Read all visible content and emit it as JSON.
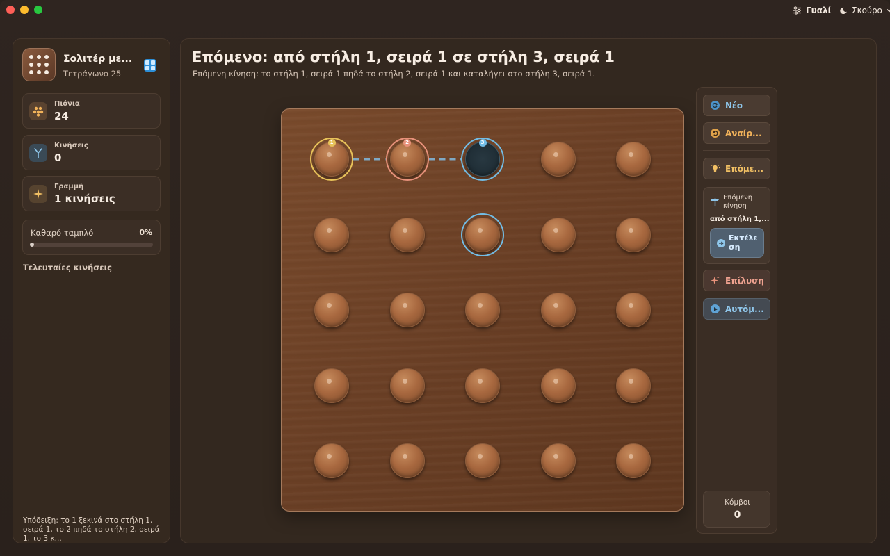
{
  "window": {
    "toolbar": {
      "glass_label": "Γυαλί",
      "theme_label": "Σκούρο"
    }
  },
  "sidebar": {
    "app_title": "Σολιτέρ με...",
    "app_subtitle": "Τετράγωνο 25",
    "stats": [
      {
        "label": "Πιόνια",
        "value": "24",
        "icon": "pegs-icon"
      },
      {
        "label": "Κινήσεις",
        "value": "0",
        "icon": "moves-icon"
      },
      {
        "label": "Γραμμή",
        "value": "1 κινήσεις",
        "icon": "sparkle-icon"
      }
    ],
    "progress": {
      "label": "Καθαρό ταμπλό",
      "percent_text": "0%",
      "value": 0
    },
    "recent_title": "Τελευταίες κινήσεις",
    "hint": "Υπόδειξη: το 1 ξεκινά στο στήλη 1, σειρά 1, το 2 πηδά το στήλη 2, σειρά 1, το 3 κ..."
  },
  "main": {
    "title": "Επόμενο: από στήλη 1, σειρά 1 σε στήλη 3, σειρά 1",
    "subtitle": "Επόμενη κίνηση: το στήλη 1, σειρά 1 πηδά το στήλη 2, σειρά 1 και καταλήγει στο στήλη 3, σειρά 1."
  },
  "board": {
    "rows": 5,
    "cols": 5,
    "empty_cells": [
      [
        0,
        2
      ]
    ],
    "highlights": [
      {
        "row": 0,
        "col": 0,
        "badge": "1",
        "color": "#e8c35a"
      },
      {
        "row": 0,
        "col": 1,
        "badge": "2",
        "color": "#e8927b"
      },
      {
        "row": 0,
        "col": 2,
        "badge": "3",
        "color": "#72bde6"
      },
      {
        "row": 1,
        "col": 2,
        "badge": "",
        "color": "#72bde6"
      }
    ],
    "path_color": "#7fa9c4"
  },
  "actions": {
    "new_label": "Νέο",
    "undo_label": "Αναίρ...",
    "hint_label": "Επόμε...",
    "next_move_title": "Επόμενη κίνηση",
    "next_move_detail": "από στήλη 1,...",
    "execute_label": "Εκτέλε ση",
    "solve_label": "Επίλυση",
    "auto_label": "Αυτόμ...",
    "knots_label": "Κόμβοι",
    "knots_value": "0"
  }
}
